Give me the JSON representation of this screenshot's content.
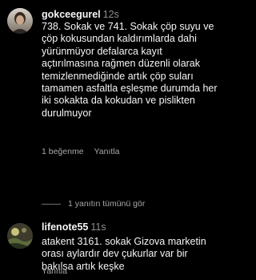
{
  "comments": [
    {
      "username": "gokceegurel",
      "time": "12s",
      "text": "738. Sokak ve 741. Sokak çöp suyu ve çöp kokusundan kaldırımlarda dahi yürünmüyor defalarca kayıt açtırılmasına rağmen düzenli olarak temizlenmediğinde artık çöp suları tamamen asfaltla eşleşme durumda her iki sokakta da kokudan ve pislikten durulmuyor",
      "likes": "1 beğenme",
      "reply": "Yanıtla",
      "view_replies": "1 yanıtın tümünü gör"
    },
    {
      "username": "lifenote55",
      "time": "11s",
      "text": "atakent 3161. sokak Gizova marketin orası aylardır dev çukurlar var bir bakılsa artık keşke",
      "reply": "Yanıtla"
    }
  ],
  "colors": {
    "background": "#000000",
    "text": "#f5f5f5",
    "secondary": "#a8a8a8",
    "timestamp": "#8e8e8e"
  }
}
